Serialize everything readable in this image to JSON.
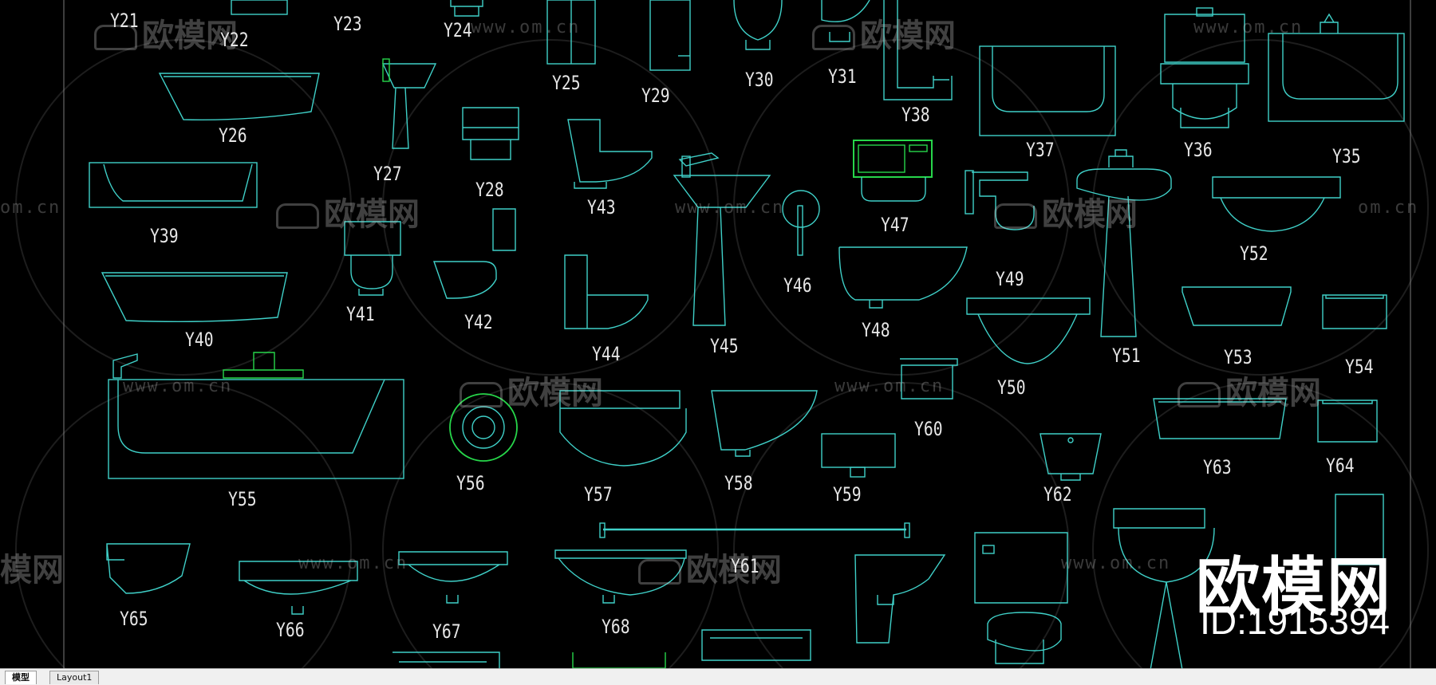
{
  "labels": [
    "Y21",
    "Y22",
    "Y23",
    "Y24",
    "Y25",
    "Y29",
    "Y30",
    "Y31",
    "Y38",
    "Y37",
    "Y36",
    "Y35",
    "Y26",
    "Y27",
    "Y28",
    "Y43",
    "Y39",
    "Y47",
    "Y46",
    "Y49",
    "Y52",
    "Y40",
    "Y41",
    "Y42",
    "Y44",
    "Y45",
    "Y48",
    "Y51",
    "Y53",
    "Y50",
    "Y54",
    "Y55",
    "Y56",
    "Y57",
    "Y58",
    "Y59",
    "Y60",
    "Y62",
    "Y63",
    "Y64",
    "Y65",
    "Y66",
    "Y67",
    "Y68",
    "Y61"
  ],
  "watermark": {
    "url": "www.om.cn",
    "url_partial": "om.cn",
    "logo": "欧模网",
    "logo_partial": "模网"
  },
  "brand": {
    "name": "欧模网",
    "id": "ID:1915394"
  },
  "tabs": {
    "model": "模型",
    "layout": "Layout1"
  },
  "colors": {
    "background": "#000000",
    "stroke": "#3fd0c8",
    "green": "#27d64a",
    "label": "#e6e6e6"
  }
}
